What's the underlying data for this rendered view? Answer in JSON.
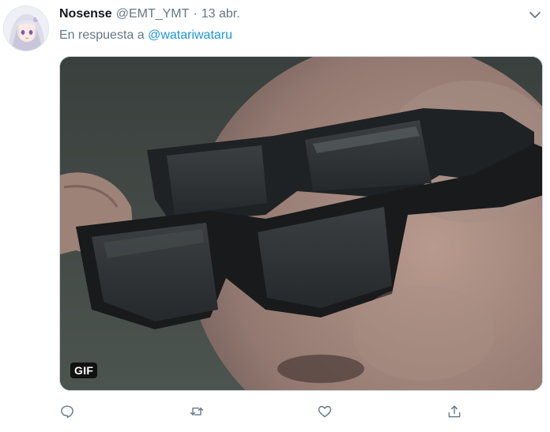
{
  "tweet": {
    "author_name": "Nosense",
    "author_handle": "@EMT_YMT",
    "separator": "·",
    "date": "13 abr.",
    "reply_prefix": "En respuesta a",
    "reply_mention": "@watariwataru",
    "media_badge": "GIF"
  },
  "icons": {
    "more": "chevron-down-icon",
    "reply": "speech-bubble-icon",
    "retweet": "retweet-icon",
    "like": "heart-icon",
    "share": "share-icon"
  },
  "colors": {
    "text_primary": "#14171a",
    "text_secondary": "#657786",
    "link": "#1b95e0",
    "icon": "#657786"
  }
}
